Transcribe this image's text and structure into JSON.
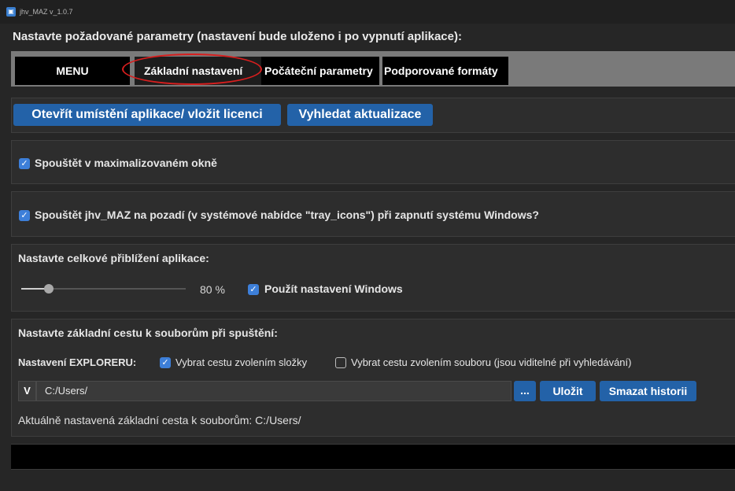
{
  "window": {
    "title": "jhv_MAZ v_1.0.7",
    "icon": "app-icon"
  },
  "prompt": "Nastavte požadované parametry (nastavení bude uloženo i po vypnutí aplikace):",
  "tabs": [
    {
      "label": "MENU"
    },
    {
      "label": "Základní nastavení"
    },
    {
      "label": "Počáteční parametry"
    },
    {
      "label": "Podporované formáty"
    }
  ],
  "buttons": {
    "open_location": "Otevřít umístění aplikace/ vložit licenci",
    "check_updates": "Vyhledat aktualizace"
  },
  "options": {
    "maximized": {
      "label": "Spouštět v maximalizovaném okně",
      "checked": true
    },
    "startup": {
      "label": "Spouštět jhv_MAZ na pozadí (v systémové nabídce \"tray_icons\") při zapnutí systému Windows?",
      "checked": true
    }
  },
  "zoom": {
    "heading": "Nastavte celkové přiblížení aplikace:",
    "value_label": "80 %",
    "slider_fraction": 0.08,
    "use_windows": {
      "label": "Použít nastavení Windows",
      "checked": true
    }
  },
  "path": {
    "heading": "Nastavte základní cestu k souborům při spuštění:",
    "explorer_label": "Nastavení EXPLORERU:",
    "pick_folder": {
      "label": "Vybrat cestu zvolením složky",
      "checked": true
    },
    "pick_file": {
      "label": "Vybrat cestu zvolením souboru (jsou viditelné při vyhledávání)",
      "checked": false
    },
    "v_button": "V",
    "value": "C:/Users/",
    "browse_button": "...",
    "save_button": "Uložit",
    "clear_history_button": "Smazat historii",
    "current_text": "Aktuálně nastavená základní cesta k souborům: C:/Users/"
  },
  "colors": {
    "accent": "#2362a8",
    "checkbox": "#3d7fd9",
    "highlight_ellipse": "#d81e1e"
  }
}
